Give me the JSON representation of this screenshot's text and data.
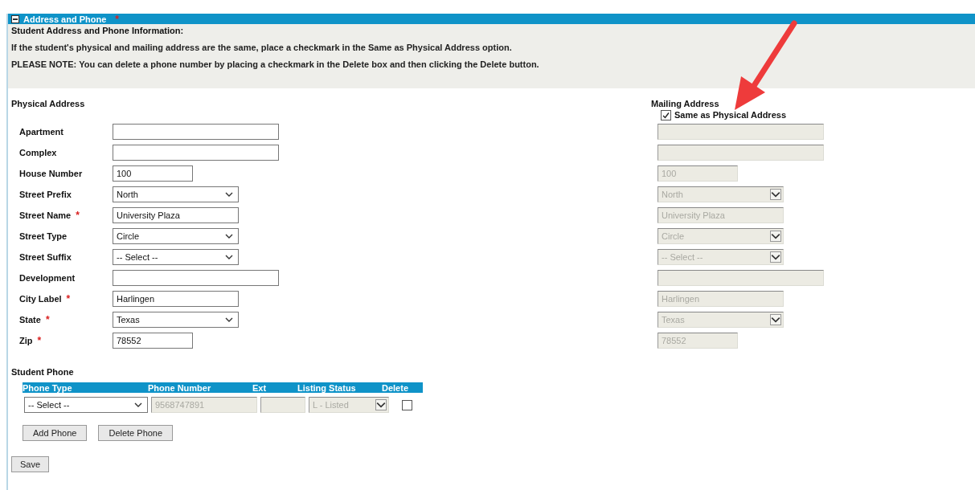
{
  "section": {
    "title": "Address and Phone",
    "required_mark": "*",
    "expanded": true
  },
  "info": {
    "heading": "Student Address and Phone Information:",
    "lines": [
      "If the student's physical and mailing address are the same, place a checkmark in the Same as Physical Address option.",
      "PLEASE NOTE: You can delete a phone number by placing a checkmark in the Delete box and then clicking the Delete button."
    ]
  },
  "physical": {
    "heading": "Physical Address",
    "fields": [
      {
        "label": "Apartment",
        "kind": "long_text"
      },
      {
        "label": "Complex",
        "kind": "long_text"
      },
      {
        "label": "House Number",
        "kind": "short_text",
        "value": "100"
      },
      {
        "label": "Street Prefix",
        "kind": "select",
        "value": "North"
      },
      {
        "label": "Street Name",
        "required_mark": "*",
        "kind": "text",
        "value": "University Plaza"
      },
      {
        "label": "Street Type",
        "kind": "select",
        "value": "Circle"
      },
      {
        "label": "Street Suffix",
        "kind": "select",
        "value": "-- Select --"
      },
      {
        "label": "Development",
        "kind": "long_text"
      },
      {
        "label": "City Label",
        "required_mark": "*",
        "kind": "text",
        "value": "Harlingen"
      },
      {
        "label": "State",
        "required_mark": "*",
        "kind": "select",
        "value": "Texas"
      },
      {
        "label": "Zip",
        "required_mark": "*",
        "kind": "short_text",
        "value": "78552"
      }
    ]
  },
  "mailing": {
    "heading": "Mailing Address",
    "same_as_physical": {
      "label": "Same as Physical Address",
      "checked": true
    },
    "fields": [
      {
        "kind": "long_text",
        "disabled": true
      },
      {
        "kind": "long_text",
        "disabled": true
      },
      {
        "kind": "short_text",
        "value": "100",
        "disabled": true
      },
      {
        "kind": "select",
        "value": "North",
        "disabled": true
      },
      {
        "kind": "text",
        "value": "University Plaza",
        "disabled": true
      },
      {
        "kind": "select",
        "value": "Circle",
        "disabled": true
      },
      {
        "kind": "select",
        "value": "-- Select --",
        "disabled": true
      },
      {
        "kind": "long_text",
        "disabled": true
      },
      {
        "kind": "text",
        "value": "Harlingen",
        "disabled": true
      },
      {
        "kind": "select",
        "value": "Texas",
        "disabled": true
      },
      {
        "kind": "short_text",
        "value": "78552",
        "disabled": true
      }
    ]
  },
  "phone": {
    "heading": "Student Phone",
    "columns": [
      "Phone Type",
      "Phone Number",
      "Ext",
      "Listing Status",
      "Delete"
    ],
    "rows": [
      {
        "phone_type": "-- Select --",
        "phone_number": "9568747891",
        "listing_status": "L - Listed",
        "delete": false,
        "disabled": true
      }
    ],
    "buttons": [
      "Add Phone",
      "Delete Phone"
    ]
  },
  "save_button": "Save"
}
